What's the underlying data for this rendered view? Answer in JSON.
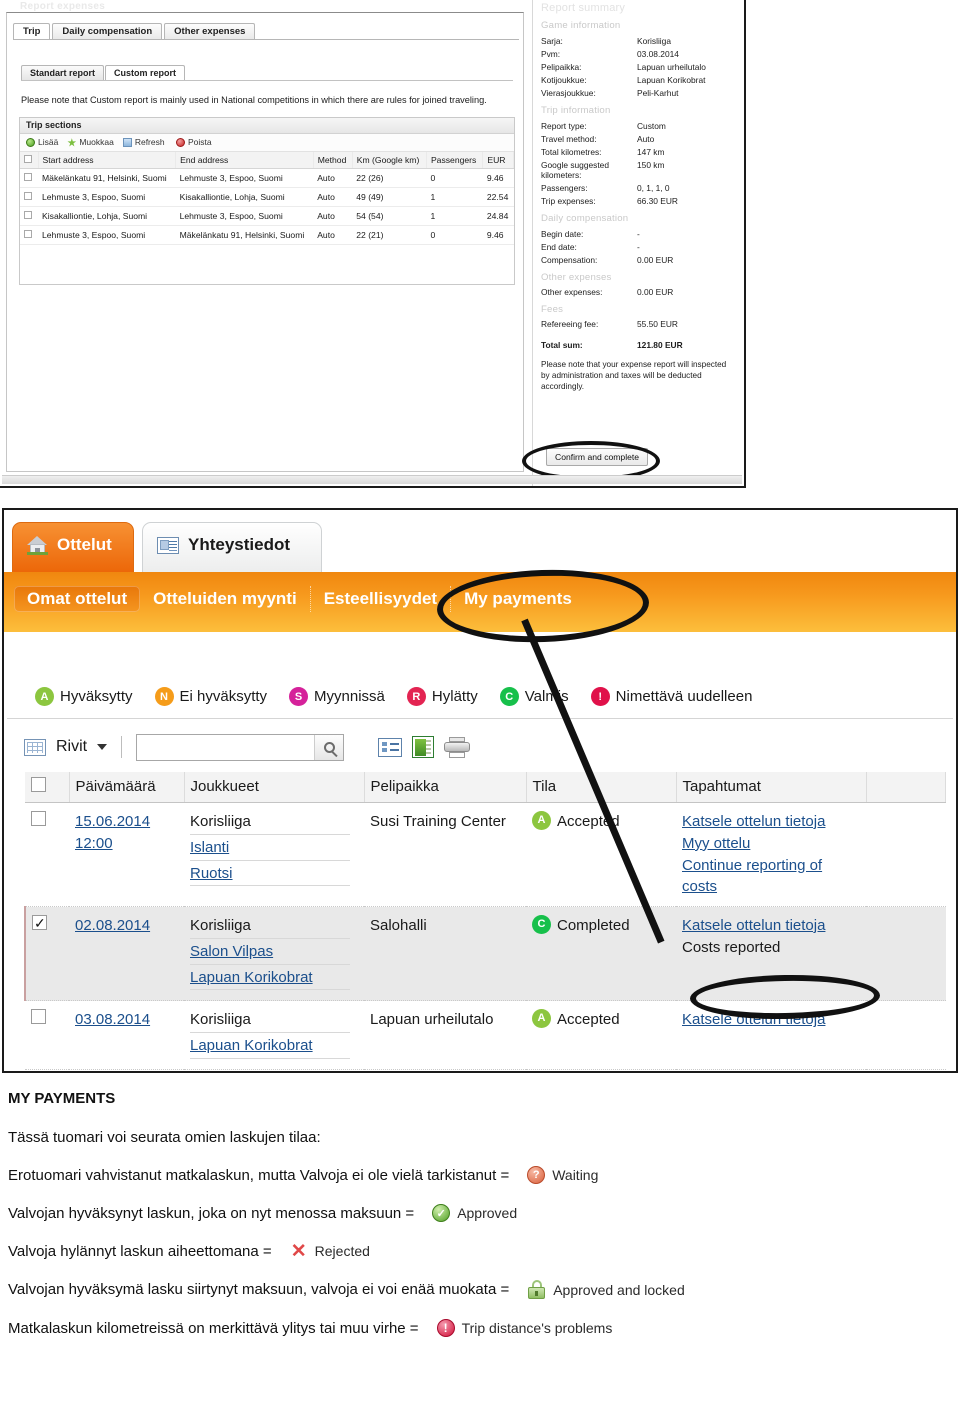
{
  "top_panel": {
    "breadcrumb_faint": "Report expenses",
    "tabs": [
      {
        "label": "Trip",
        "active": true
      },
      {
        "label": "Daily compensation",
        "active": false
      },
      {
        "label": "Other expenses",
        "active": false
      }
    ],
    "subtabs": [
      {
        "label": "Standart report",
        "active": false
      },
      {
        "label": "Custom report",
        "active": true
      }
    ],
    "note": "Please note that Custom report is mainly used in National competitions in which there are rules for joined traveling.",
    "trip_sections": {
      "title": "Trip sections",
      "tools": [
        "Lisää",
        "Muokkaa",
        "Refresh",
        "Poista"
      ],
      "columns": [
        "Start address",
        "End address",
        "Method",
        "Km (Google km)",
        "Passengers",
        "EUR"
      ],
      "rows": [
        {
          "start": "Mäkelänkatu 91, Helsinki, Suomi",
          "end": "Lehmuste 3, Espoo, Suomi",
          "method": "Auto",
          "km": "22 (26)",
          "pass": "0",
          "eur": "9.46"
        },
        {
          "start": "Lehmuste 3, Espoo, Suomi",
          "end": "Kisakalliontie, Lohja, Suomi",
          "method": "Auto",
          "km": "49 (49)",
          "pass": "1",
          "eur": "22.54"
        },
        {
          "start": "Kisakalliontie, Lohja, Suomi",
          "end": "Lehmuste 3, Espoo, Suomi",
          "method": "Auto",
          "km": "54 (54)",
          "pass": "1",
          "eur": "24.84"
        },
        {
          "start": "Lehmuste 3, Espoo, Suomi",
          "end": "Mäkelänkatu 91, Helsinki, Suomi",
          "method": "Auto",
          "km": "22 (21)",
          "pass": "0",
          "eur": "9.46"
        }
      ]
    },
    "summary": {
      "heading": "Report summary",
      "game_information": {
        "title": "Game information",
        "rows": [
          {
            "k": "Sarja:",
            "v": "Korisliiga"
          },
          {
            "k": "Pvm:",
            "v": "03.08.2014"
          },
          {
            "k": "Pelipaikka:",
            "v": "Lapuan urheilutalo"
          },
          {
            "k": "Kotijoukkue:",
            "v": "Lapuan Korikobrat"
          },
          {
            "k": "Vierasjoukkue:",
            "v": "Peli-Karhut"
          }
        ]
      },
      "trip_information": {
        "title": "Trip information",
        "rows": [
          {
            "k": "Report type:",
            "v": "Custom"
          },
          {
            "k": "Travel method:",
            "v": "Auto"
          },
          {
            "k": "Total kilometres:",
            "v": "147 km"
          },
          {
            "k": "Google suggested kilometers:",
            "v": "150 km"
          },
          {
            "k": "Passengers:",
            "v": "0, 1, 1, 0"
          },
          {
            "k": "Trip expenses:",
            "v": "66.30 EUR"
          }
        ]
      },
      "daily_compensation": {
        "title": "Daily compensation",
        "rows": [
          {
            "k": "Begin date:",
            "v": "-"
          },
          {
            "k": "End date:",
            "v": "-"
          },
          {
            "k": "Compensation:",
            "v": "0.00 EUR"
          }
        ]
      },
      "other_expenses": {
        "title": "Other expenses",
        "rows": [
          {
            "k": "Other expenses:",
            "v": "0.00 EUR"
          }
        ]
      },
      "fees": {
        "title": "Fees",
        "rows": [
          {
            "k": "Refereeing fee:",
            "v": "55.50 EUR"
          }
        ]
      },
      "total": {
        "k": "Total sum:",
        "v": "121.80 EUR"
      },
      "disclaimer": "Please note that your expense report will inspected by administration and taxes will be deducted accordingly.",
      "confirm_button": "Confirm and complete"
    }
  },
  "bottom_panel": {
    "main_tabs": [
      {
        "label": "Ottelut",
        "icon": "home-icon",
        "active": true
      },
      {
        "label": "Yhteystiedot",
        "icon": "contact-card-icon",
        "active": false
      }
    ],
    "sub_nav": [
      {
        "label": "Omat ottelut",
        "selected": true
      },
      {
        "label": "Otteluiden myynti",
        "selected": false
      },
      {
        "label": "Esteellisyydet",
        "selected": false
      },
      {
        "label": "My payments",
        "selected": false
      }
    ],
    "legend": [
      {
        "letter": "A",
        "label": "Hyväksytty",
        "color": "#8cc63f"
      },
      {
        "letter": "N",
        "label": "Ei hyväksytty",
        "color": "#f59c1a"
      },
      {
        "letter": "S",
        "label": "Myynnissä",
        "color": "#d5219a"
      },
      {
        "letter": "R",
        "label": "Hylätty",
        "color": "#e32452"
      },
      {
        "letter": "C",
        "label": "Valmis",
        "color": "#17c04b"
      },
      {
        "letter": "!",
        "label": "Nimettävä uudelleen",
        "color": "#e0114a"
      }
    ],
    "toolbar": {
      "rows_label": "Rivit",
      "search_value": "",
      "search_placeholder": "",
      "icons": [
        "grid-icon",
        "details-list-icon",
        "excel-export-icon",
        "print-icon"
      ]
    },
    "table": {
      "columns": [
        "",
        "Päivämäärä",
        "Joukkueet",
        "Pelipaikka",
        "Tila",
        "Tapahtumat",
        ""
      ],
      "rows": [
        {
          "checked": false,
          "date": "15.06.2014",
          "time": "12:00",
          "teams": [
            "Korisliiga",
            "Islanti",
            "Ruotsi"
          ],
          "team_links": [
            false,
            true,
            true
          ],
          "venue": "Susi Training Center",
          "status_letter": "A",
          "status_label": "Accepted",
          "status_color": "#8cc63f",
          "actions": [
            "Katsele ottelun tietoja",
            "Myy ottelu",
            "Continue reporting of costs"
          ],
          "action_links": [
            true,
            true,
            true
          ]
        },
        {
          "checked": true,
          "date": "02.08.2014",
          "time": "",
          "teams": [
            "Korisliiga",
            "Salon Vilpas",
            "Lapuan Korikobrat"
          ],
          "team_links": [
            false,
            true,
            true
          ],
          "venue": "Salohalli",
          "status_letter": "C",
          "status_label": "Completed",
          "status_color": "#17c04b",
          "actions": [
            "Katsele ottelun tietoja",
            "Costs reported"
          ],
          "action_links": [
            true,
            false
          ]
        },
        {
          "checked": false,
          "date": "03.08.2014",
          "time": "",
          "teams": [
            "Korisliiga",
            "Lapuan Korikobrat"
          ],
          "team_links": [
            false,
            true
          ],
          "venue": "Lapuan urheilutalo",
          "status_letter": "A",
          "status_label": "Accepted",
          "status_color": "#8cc63f",
          "actions": [
            "Katsele ottelun tietoja"
          ],
          "action_links": [
            true
          ]
        }
      ]
    }
  },
  "notes": {
    "title": "MY PAYMENTS",
    "intro": "Tässä tuomari voi seurata omien laskujen tilaa:",
    "lines": [
      {
        "text": "Erotuomari vahvistanut matkalaskun, mutta Valvoja ei ole vielä tarkistanut  =",
        "badge": "Waiting",
        "badge_icon": "question-circle-icon"
      },
      {
        "text": "Valvojan hyväksynyt laskun, joka on nyt menossa maksuun =",
        "badge": "Approved",
        "badge_icon": "check-circle-icon"
      },
      {
        "text": "Valvoja hylännyt laskun aiheettomana =",
        "badge": "Rejected",
        "badge_icon": "red-x-icon"
      },
      {
        "text": "Valvojan hyväksymä lasku siirtynyt maksuun, valvoja ei voi enää muokata =",
        "badge": "Approved and locked",
        "badge_icon": "lock-icon"
      },
      {
        "text": "Matkalaskun kilometreissä on merkittävä ylitys tai muu virhe =",
        "badge": "Trip distance's problems",
        "badge_icon": "exclamation-circle-icon"
      }
    ]
  }
}
